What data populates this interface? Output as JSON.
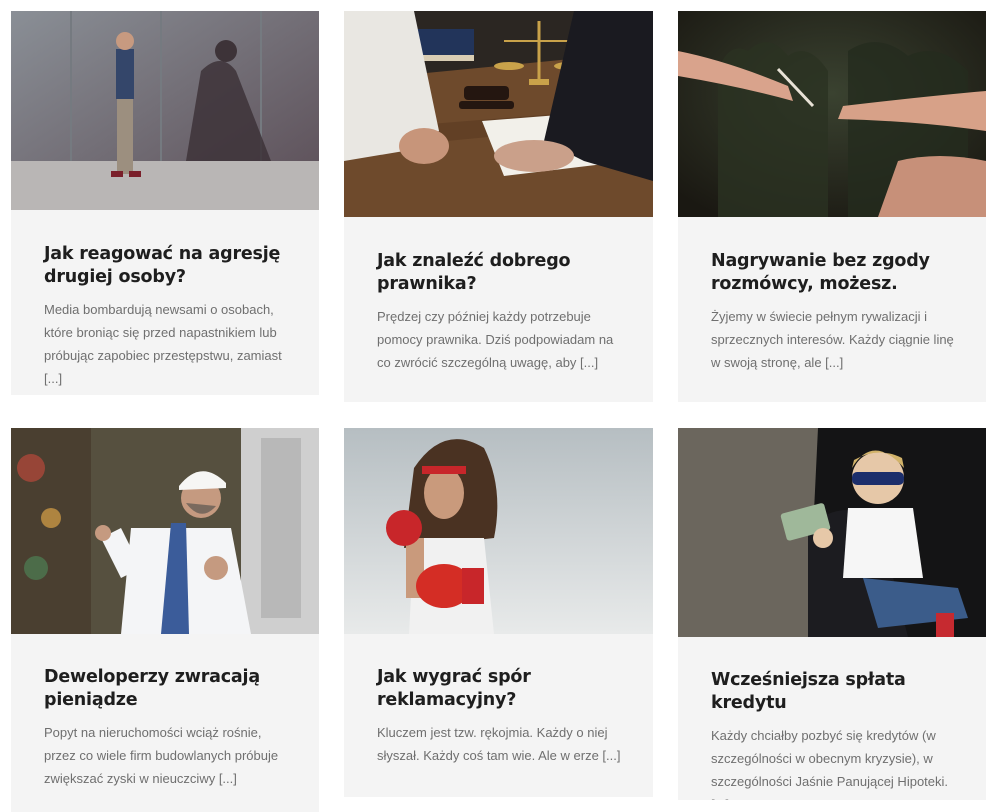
{
  "posts": [
    {
      "image": "boy-superhero-shadow-photo",
      "title": "Jak reagować na agresję drugiej osoby?",
      "excerpt": "Media bombardują newsami o osobach, które broniąc się przed napastnikiem lub próbując zapobiec przestępstwu, zamiast [...]"
    },
    {
      "image": "lawyer-desk-scales-photo",
      "title": "Jak znaleźć dobrego prawnika?",
      "excerpt": "Prędzej czy później każdy potrzebuje pomocy prawnika. Dziś podpowiadam na co zwrócić szczególną uwagę, aby [...]"
    },
    {
      "image": "hands-passing-pen-photo",
      "title": "Nagrywanie bez zgody rozmówcy, możesz.",
      "excerpt": "Żyjemy w świecie pełnym rywalizacji i sprzecznych interesów. Każdy ciągnie linę w swoją stronę, ale [...]"
    },
    {
      "image": "angry-man-hardhat-photo",
      "title": "Deweloperzy zwracają pieniądze",
      "excerpt": "Popyt na nieruchomości wciąż rośnie, przez co wiele firm budowlanych próbuje zwiększać zyski w nieuczciwy [...]"
    },
    {
      "image": "boxer-man-gloves-photo",
      "title": "Jak wygrać spór reklamacyjny?",
      "excerpt": "Kluczem jest tzw. rękojmia. Każdy o niej słyszał. Każdy coś tam wie. Ale w erze [...]"
    },
    {
      "image": "kid-sunglasses-money-photo",
      "title": "Wcześniejsza spłata kredytu",
      "excerpt": "Każdy chciałby pozbyć się kredytów (w szczególności w obecnym kryzysie), w szczególności Jaśnie Panującej Hipoteki. [...]"
    }
  ]
}
